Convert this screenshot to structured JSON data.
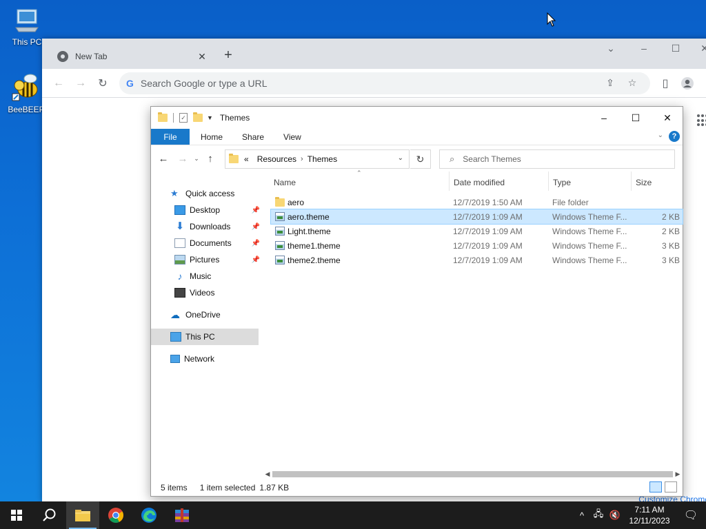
{
  "desktop": {
    "icons": [
      {
        "label": "This PC"
      },
      {
        "label": "BeeBEEP"
      }
    ]
  },
  "chrome": {
    "tab_title": "New Tab",
    "omnibox_placeholder": "Search Google or type a URL",
    "customize_label": "Customize Chrome"
  },
  "explorer": {
    "title": "Themes",
    "ribbon": {
      "file": "File",
      "home": "Home",
      "share": "Share",
      "view": "View",
      "help": "?"
    },
    "address": {
      "overflow": "«",
      "crumbs": [
        "Resources",
        "Themes"
      ]
    },
    "search_placeholder": "Search Themes",
    "nav_pane": {
      "quick_access": "Quick access",
      "pinned": [
        "Desktop",
        "Downloads",
        "Documents",
        "Pictures"
      ],
      "unpinned": [
        "Music",
        "Videos"
      ],
      "onedrive": "OneDrive",
      "this_pc": "This PC",
      "network": "Network"
    },
    "columns": {
      "name": "Name",
      "date": "Date modified",
      "type": "Type",
      "size": "Size"
    },
    "files": [
      {
        "name": "aero",
        "date": "12/7/2019 1:50 AM",
        "type": "File folder",
        "size": "",
        "kind": "folder",
        "selected": false
      },
      {
        "name": "aero.theme",
        "date": "12/7/2019 1:09 AM",
        "type": "Windows Theme F...",
        "size": "2 KB",
        "kind": "theme",
        "selected": true
      },
      {
        "name": "Light.theme",
        "date": "12/7/2019 1:09 AM",
        "type": "Windows Theme F...",
        "size": "2 KB",
        "kind": "theme",
        "selected": false
      },
      {
        "name": "theme1.theme",
        "date": "12/7/2019 1:09 AM",
        "type": "Windows Theme F...",
        "size": "3 KB",
        "kind": "theme",
        "selected": false
      },
      {
        "name": "theme2.theme",
        "date": "12/7/2019 1:09 AM",
        "type": "Windows Theme F...",
        "size": "3 KB",
        "kind": "theme",
        "selected": false
      }
    ],
    "status": {
      "items": "5 items",
      "selected": "1 item selected",
      "size": "1.87 KB"
    }
  },
  "taskbar": {
    "apps": [
      "start-button",
      "search-button",
      "file-explorer",
      "chrome",
      "edge",
      "winrar"
    ],
    "time": "7:11 AM",
    "date": "12/11/2023"
  },
  "colors": {
    "accent": "#1979ca",
    "selection": "#cce8ff",
    "desktop": "#0d6fd6"
  }
}
